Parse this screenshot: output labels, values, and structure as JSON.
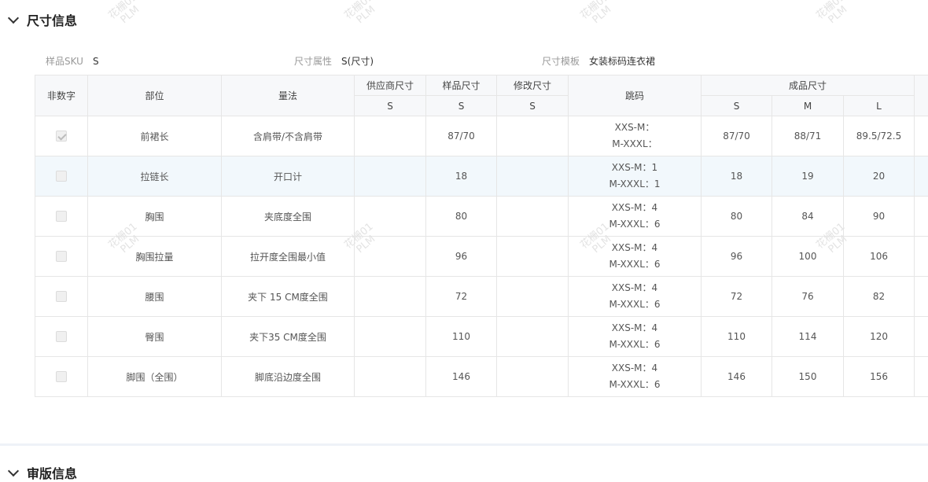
{
  "section": {
    "title": "尺寸信息",
    "next_title": "审版信息"
  },
  "meta": {
    "sku_label": "样品SKU",
    "sku_value": "S",
    "attr_label": "尺寸属性",
    "attr_value": "S(尺寸)",
    "template_label": "尺寸模板",
    "template_value": "女装标码连衣裙"
  },
  "table": {
    "headers": {
      "non_numeric": "非数字",
      "part": "部位",
      "method": "量法",
      "supplier": "供应商尺寸",
      "sample": "样品尺寸",
      "modify": "修改尺寸",
      "jump": "跳码",
      "finished": "成品尺寸",
      "supplier_sub": "S",
      "sample_sub": "S",
      "modify_sub": "S",
      "finished_sizes": [
        "S",
        "M",
        "L"
      ]
    },
    "rows": [
      {
        "checked": true,
        "part": "前裙长",
        "method": "含肩带/不含肩带",
        "supplier": "",
        "sample": "87/70",
        "modify": "",
        "jump1": "XXS-M：",
        "jump2": "M-XXXL：",
        "s": "87/70",
        "m": "88/71",
        "l": "89.5/72.5"
      },
      {
        "checked": false,
        "part": "拉链长",
        "method": "开口计",
        "supplier": "",
        "sample": "18",
        "modify": "",
        "jump1": "XXS-M：1",
        "jump2": "M-XXXL：1",
        "s": "18",
        "m": "19",
        "l": "20"
      },
      {
        "checked": false,
        "part": "胸围",
        "method": "夹底度全围",
        "supplier": "",
        "sample": "80",
        "modify": "",
        "jump1": "XXS-M：4",
        "jump2": "M-XXXL：6",
        "s": "80",
        "m": "84",
        "l": "90"
      },
      {
        "checked": false,
        "part": "胸围拉量",
        "method": "拉开度全围最小值",
        "supplier": "",
        "sample": "96",
        "modify": "",
        "jump1": "XXS-M：4",
        "jump2": "M-XXXL：6",
        "s": "96",
        "m": "100",
        "l": "106"
      },
      {
        "checked": false,
        "part": "腰围",
        "method": "夹下 15 CM度全围",
        "supplier": "",
        "sample": "72",
        "modify": "",
        "jump1": "XXS-M：4",
        "jump2": "M-XXXL：6",
        "s": "72",
        "m": "76",
        "l": "82"
      },
      {
        "checked": false,
        "part": "臀围",
        "method": "夹下35 CM度全围",
        "supplier": "",
        "sample": "110",
        "modify": "",
        "jump1": "XXS-M：4",
        "jump2": "M-XXXL：6",
        "s": "110",
        "m": "114",
        "l": "120"
      },
      {
        "checked": false,
        "part": "脚围（全围）",
        "method": "脚底沿边度全围",
        "supplier": "",
        "sample": "146",
        "modify": "",
        "jump1": "XXS-M：4",
        "jump2": "M-XXXL：6",
        "s": "146",
        "m": "150",
        "l": "156"
      }
    ]
  },
  "watermark": {
    "line1": "花栅01",
    "line2": "PLM"
  }
}
